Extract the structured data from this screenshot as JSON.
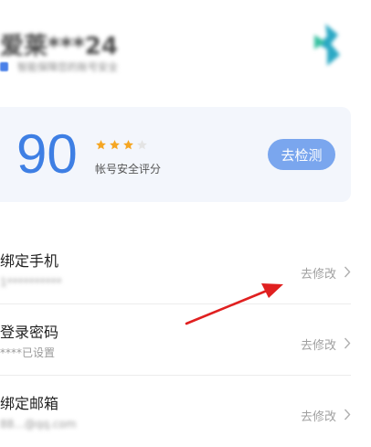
{
  "header": {
    "username": "爱莱***24",
    "subtitle": "智能保障您的账号安全"
  },
  "score_card": {
    "score": "90",
    "stars_filled": 3,
    "stars_total": 4,
    "label": "帐号安全评分",
    "button_label": "去检测",
    "accent_color": "#3e7fe4",
    "star_color": "#f5a623"
  },
  "items": [
    {
      "title": "绑定手机",
      "value": "1**********",
      "action": "去修改"
    },
    {
      "title": "登录密码",
      "value": "****已设置",
      "action": "去修改"
    },
    {
      "title": "绑定邮箱",
      "value": "88...@qq.com",
      "action": "去修改"
    }
  ],
  "annotation": {
    "color": "#e02020"
  }
}
